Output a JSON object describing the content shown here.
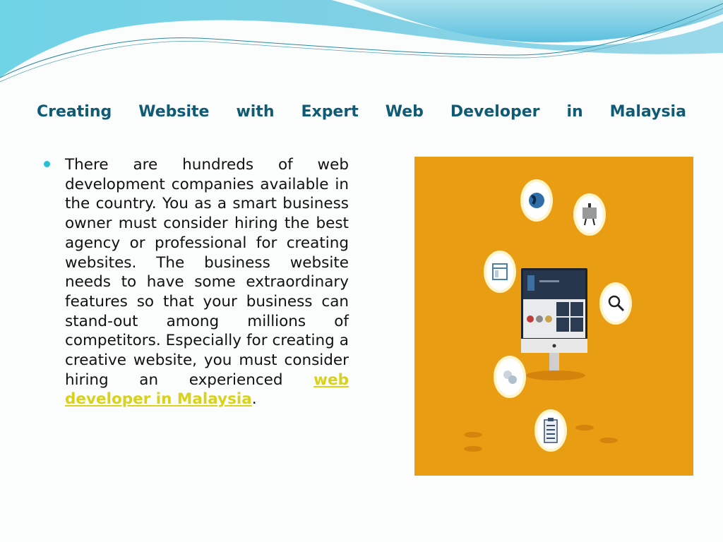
{
  "slide": {
    "title_words": [
      "Creating",
      "Website",
      "with",
      "Expert",
      "Web",
      "Developer",
      "in",
      "Malaysia"
    ],
    "bullet": {
      "text": "There are hundreds of web development companies available in the country. You as a smart business owner must consider hiring the best agency or professional for creating websites. The business website needs to have some extraordinary features so that your business can stand-out among millions of competitors. Especially for creating a creative website, you must consider hiring an experienced ",
      "link_text": "web developer in Malaysia",
      "trailing": "."
    },
    "illustration": {
      "description": "web-development-illustration",
      "background_color": "#e89d13",
      "icons": [
        "globe-icon",
        "presentation-board-icon",
        "browser-window-icon",
        "magnifier-icon",
        "gears-icon",
        "clipboard-checklist-icon"
      ]
    },
    "colors": {
      "title": "#0f5a74",
      "bullet": "#27c0d6",
      "link": "#d9d21a"
    }
  }
}
